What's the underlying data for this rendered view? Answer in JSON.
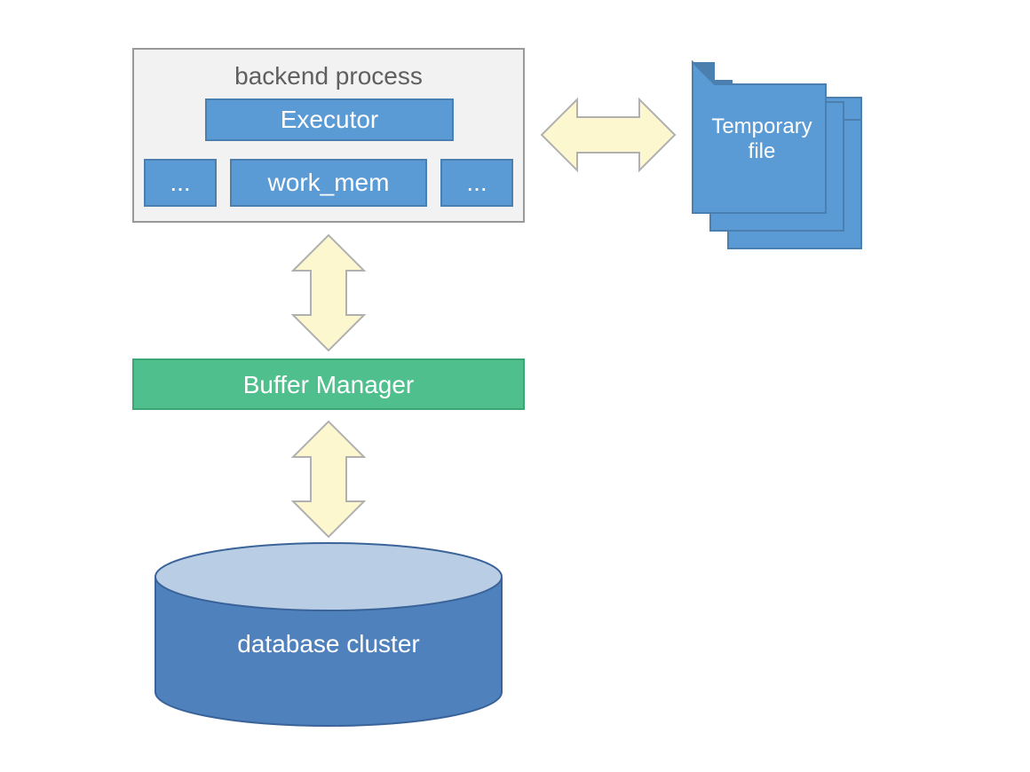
{
  "diagram": {
    "backend_process": {
      "title": "backend process",
      "executor": "Executor",
      "block_left": "...",
      "block_mid": "work_mem",
      "block_right": "..."
    },
    "temp_file": {
      "line1": "Temporary",
      "line2": "file"
    },
    "buffer_manager": "Buffer Manager",
    "database_cluster": "database cluster",
    "colors": {
      "panel_fill": "#f2f2f2",
      "panel_stroke": "#999999",
      "blue_fill": "#5b9bd5",
      "blue_stroke": "#4a7fb0",
      "green_fill": "#4fc08d",
      "green_stroke": "#3da674",
      "arrow_fill": "#fcf7cf",
      "arrow_stroke": "#b0b0b0",
      "cylinder_top": "#b9cde5",
      "cylinder_side": "#4f81bd"
    }
  }
}
